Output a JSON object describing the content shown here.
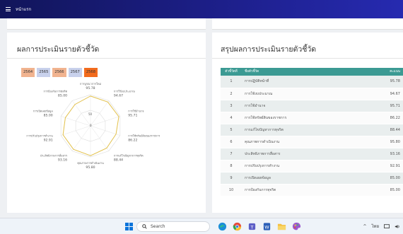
{
  "header": {
    "title": "หน้าแรก",
    "bg_color": "#1b1e84"
  },
  "left_card": {
    "title": "ผลการประเมินรายตัวชี้วัด",
    "year_chips": [
      {
        "label": "2564",
        "color": "#f1b38f"
      },
      {
        "label": "2565",
        "color": "#c8d1ec"
      },
      {
        "label": "2566",
        "color": "#f1b38f"
      },
      {
        "label": "2567",
        "color": "#c8d1ec"
      },
      {
        "label": "2568",
        "color": "#f26b1d"
      }
    ],
    "radar": {
      "center_label": "0",
      "ring_labels": [
        "50",
        "0"
      ],
      "axes": [
        {
          "label": "การบูรณาการใหม่",
          "value": "95.78"
        },
        {
          "label": "การใช้งบประมาณ",
          "value": "94.67"
        },
        {
          "label": "การใช้อำนาจ",
          "value": "95.71"
        },
        {
          "label": "การใช้ทรัพย์สินของราชการ",
          "value": "86.22"
        },
        {
          "label": "การแก้ไขปัญหาการทุจริต",
          "value": "88.44"
        },
        {
          "label": "คุณภาพการดำเนินงาน",
          "value": "95.80"
        },
        {
          "label": "ประสิทธิภาพการสื่อสาร",
          "value": "93.16"
        },
        {
          "label": "การปรับปรุงการทำงาน",
          "value": "92.91"
        },
        {
          "label": "การเปิดเผยข้อมูล",
          "value": "85.00"
        },
        {
          "label": "การป้องกันการทุจริต",
          "value": "85.00"
        }
      ]
    }
  },
  "right_card": {
    "title": "สรุปผลการประเมินรายตัวชี้วัด",
    "table": {
      "headers": [
        "ตัวชี้วัดที่",
        "ชื่อตัวชี้วัด",
        "คะแนน"
      ],
      "header_color": "#3b9a93",
      "rows": [
        {
          "no": "1",
          "name": "การปฏิบัติหน้าที่",
          "score": "95.78"
        },
        {
          "no": "2",
          "name": "การใช้งบประมาณ",
          "score": "94.67"
        },
        {
          "no": "3",
          "name": "การใช้อำนาจ",
          "score": "95.71"
        },
        {
          "no": "4",
          "name": "การใช้ทรัพย์สินของราชการ",
          "score": "86.22"
        },
        {
          "no": "5",
          "name": "การแก้ไขปัญหาการทุจริต",
          "score": "88.44"
        },
        {
          "no": "6",
          "name": "คุณภาพการดำเนินงาน",
          "score": "95.80"
        },
        {
          "no": "7",
          "name": "ประสิทธิภาพการสื่อสาร",
          "score": "93.16"
        },
        {
          "no": "8",
          "name": "การปรับปรุงการทำงาน",
          "score": "92.91"
        },
        {
          "no": "9",
          "name": "การเปิดเผยข้อมูล",
          "score": "85.00"
        },
        {
          "no": "10",
          "name": "การป้องกันการทุจริต",
          "score": "85.00"
        }
      ]
    }
  },
  "taskbar": {
    "search_label": "Search",
    "lang_label": "ไทย",
    "apps": [
      "edge-icon",
      "chrome-icon",
      "teams-icon",
      "word-icon",
      "file-explorer-icon",
      "paint-icon"
    ]
  }
}
